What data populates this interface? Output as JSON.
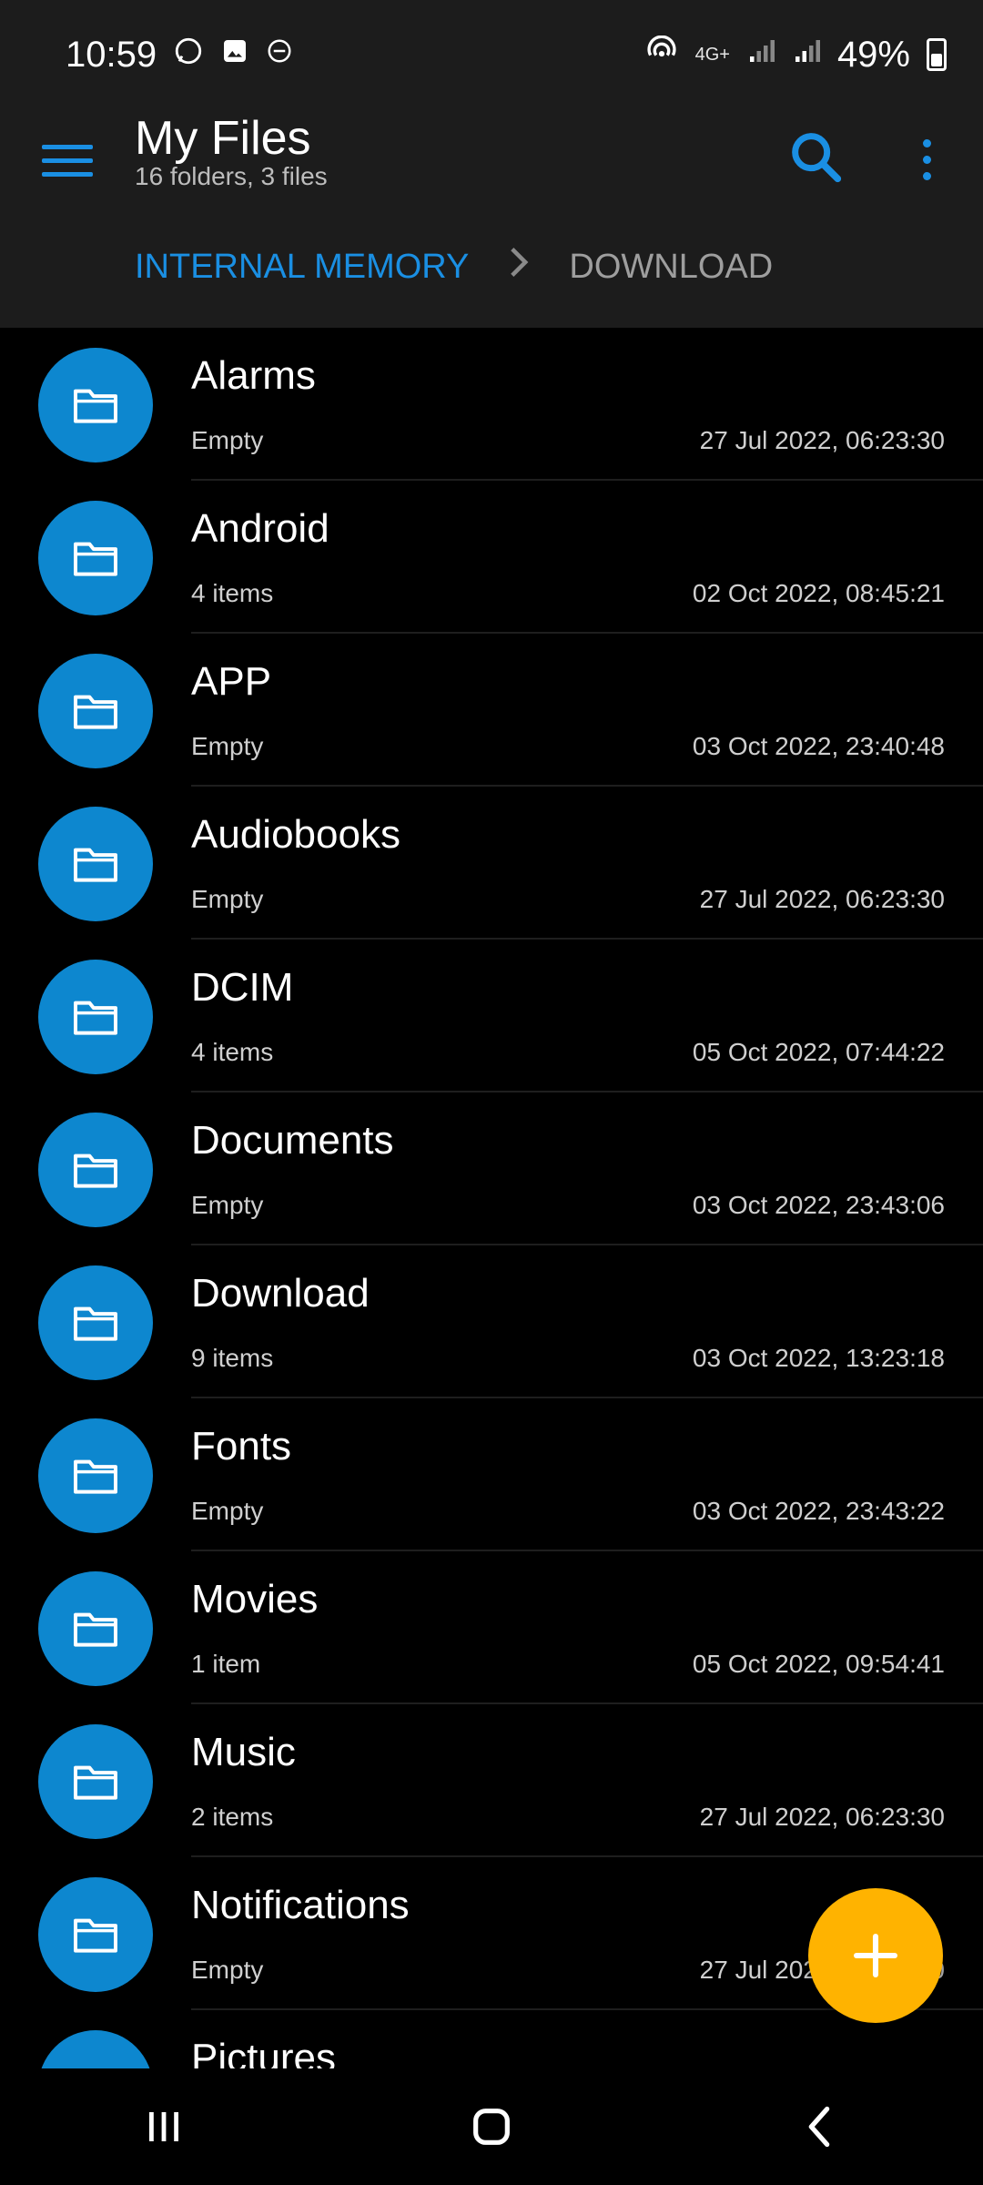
{
  "status_bar": {
    "time": "10:59",
    "battery": "49%",
    "network": "4G+"
  },
  "app_bar": {
    "title": "My Files",
    "subtitle": "16 folders, 3 files"
  },
  "breadcrumb": {
    "root": "INTERNAL MEMORY",
    "current": "DOWNLOAD"
  },
  "files": [
    {
      "name": "Alarms",
      "meta": "Empty",
      "date": "27 Jul 2022, 06:23:30"
    },
    {
      "name": "Android",
      "meta": "4 items",
      "date": "02 Oct 2022, 08:45:21"
    },
    {
      "name": "APP",
      "meta": "Empty",
      "date": "03 Oct 2022, 23:40:48"
    },
    {
      "name": "Audiobooks",
      "meta": "Empty",
      "date": "27 Jul 2022, 06:23:30"
    },
    {
      "name": "DCIM",
      "meta": "4 items",
      "date": "05 Oct 2022, 07:44:22"
    },
    {
      "name": "Documents",
      "meta": "Empty",
      "date": "03 Oct 2022, 23:43:06"
    },
    {
      "name": "Download",
      "meta": "9 items",
      "date": "03 Oct 2022, 13:23:18"
    },
    {
      "name": "Fonts",
      "meta": "Empty",
      "date": "03 Oct 2022, 23:43:22"
    },
    {
      "name": "Movies",
      "meta": "1 item",
      "date": "05 Oct 2022, 09:54:41"
    },
    {
      "name": "Music",
      "meta": "2 items",
      "date": "27 Jul 2022, 06:23:30"
    },
    {
      "name": "Notifications",
      "meta": "Empty",
      "date": "27 Jul 2022, 06:23:30"
    },
    {
      "name": "Pictures",
      "meta": "",
      "date": ""
    }
  ],
  "colors": {
    "accent": "#1a8fe3",
    "folder": "#0d87cf",
    "fab": "#ffb300",
    "app_bar": "#1c1c1c"
  }
}
